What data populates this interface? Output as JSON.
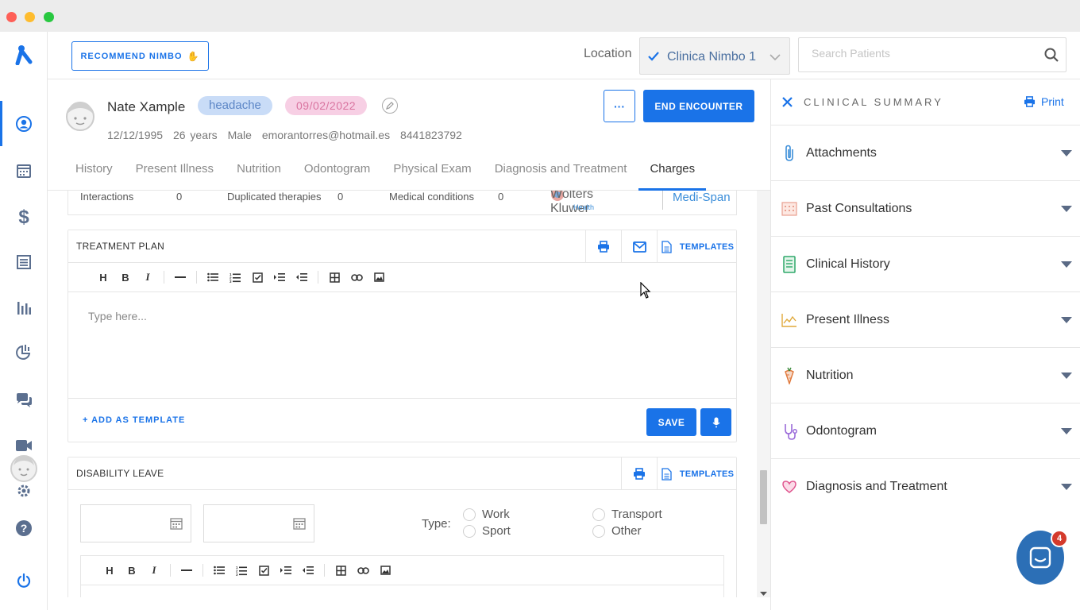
{
  "topbar": {
    "recommend_label": "RECOMMEND NIMBO",
    "location_label": "Location",
    "location_value": "Clinica Nimbo 1",
    "search_placeholder": "Search Patients"
  },
  "patient": {
    "name": "Nate Xample",
    "tag": "headache",
    "date": "09/02/2022",
    "dob": "12/12/1995",
    "age": "26 years",
    "sex": "Male",
    "email": "emorantorres@hotmail.es",
    "phone": "8441823792",
    "more_label": "···",
    "end_label": "END ENCOUNTER"
  },
  "tabs": [
    "History",
    "Present Illness",
    "Nutrition",
    "Odontogram",
    "Physical Exam",
    "Diagnosis and Treatment",
    "Charges"
  ],
  "interactions": {
    "interactions_label": "Interactions",
    "interactions_value": "0",
    "duplicated_label": "Duplicated therapies",
    "duplicated_value": "0",
    "conditions_label": "Medical conditions",
    "conditions_value": "0",
    "wk_logo": "Wolters Kluwer",
    "wk_sub": "Health",
    "medispan": "Medi-Span"
  },
  "treatment": {
    "title": "TREATMENT PLAN",
    "templates_label": "TEMPLATES",
    "placeholder": "Type here...",
    "add_template": "ADD AS TEMPLATE",
    "save_label": "SAVE"
  },
  "disability": {
    "title": "DISABILITY LEAVE",
    "templates_label": "TEMPLATES",
    "type_label": "Type:",
    "options": [
      "Work",
      "Sport",
      "Transport",
      "Other"
    ]
  },
  "clinical_summary": {
    "title": "CLINICAL SUMMARY",
    "print_label": "Print",
    "sections": [
      "Attachments",
      "Past Consultations",
      "Clinical History",
      "Present Illness",
      "Nutrition",
      "Odontogram",
      "Diagnosis and Treatment"
    ]
  },
  "chat": {
    "badge": "4"
  },
  "colors": {
    "accent": "#1a73e8",
    "tag_blue": "#c9dcf7",
    "tag_pink": "#f7cfe4"
  }
}
